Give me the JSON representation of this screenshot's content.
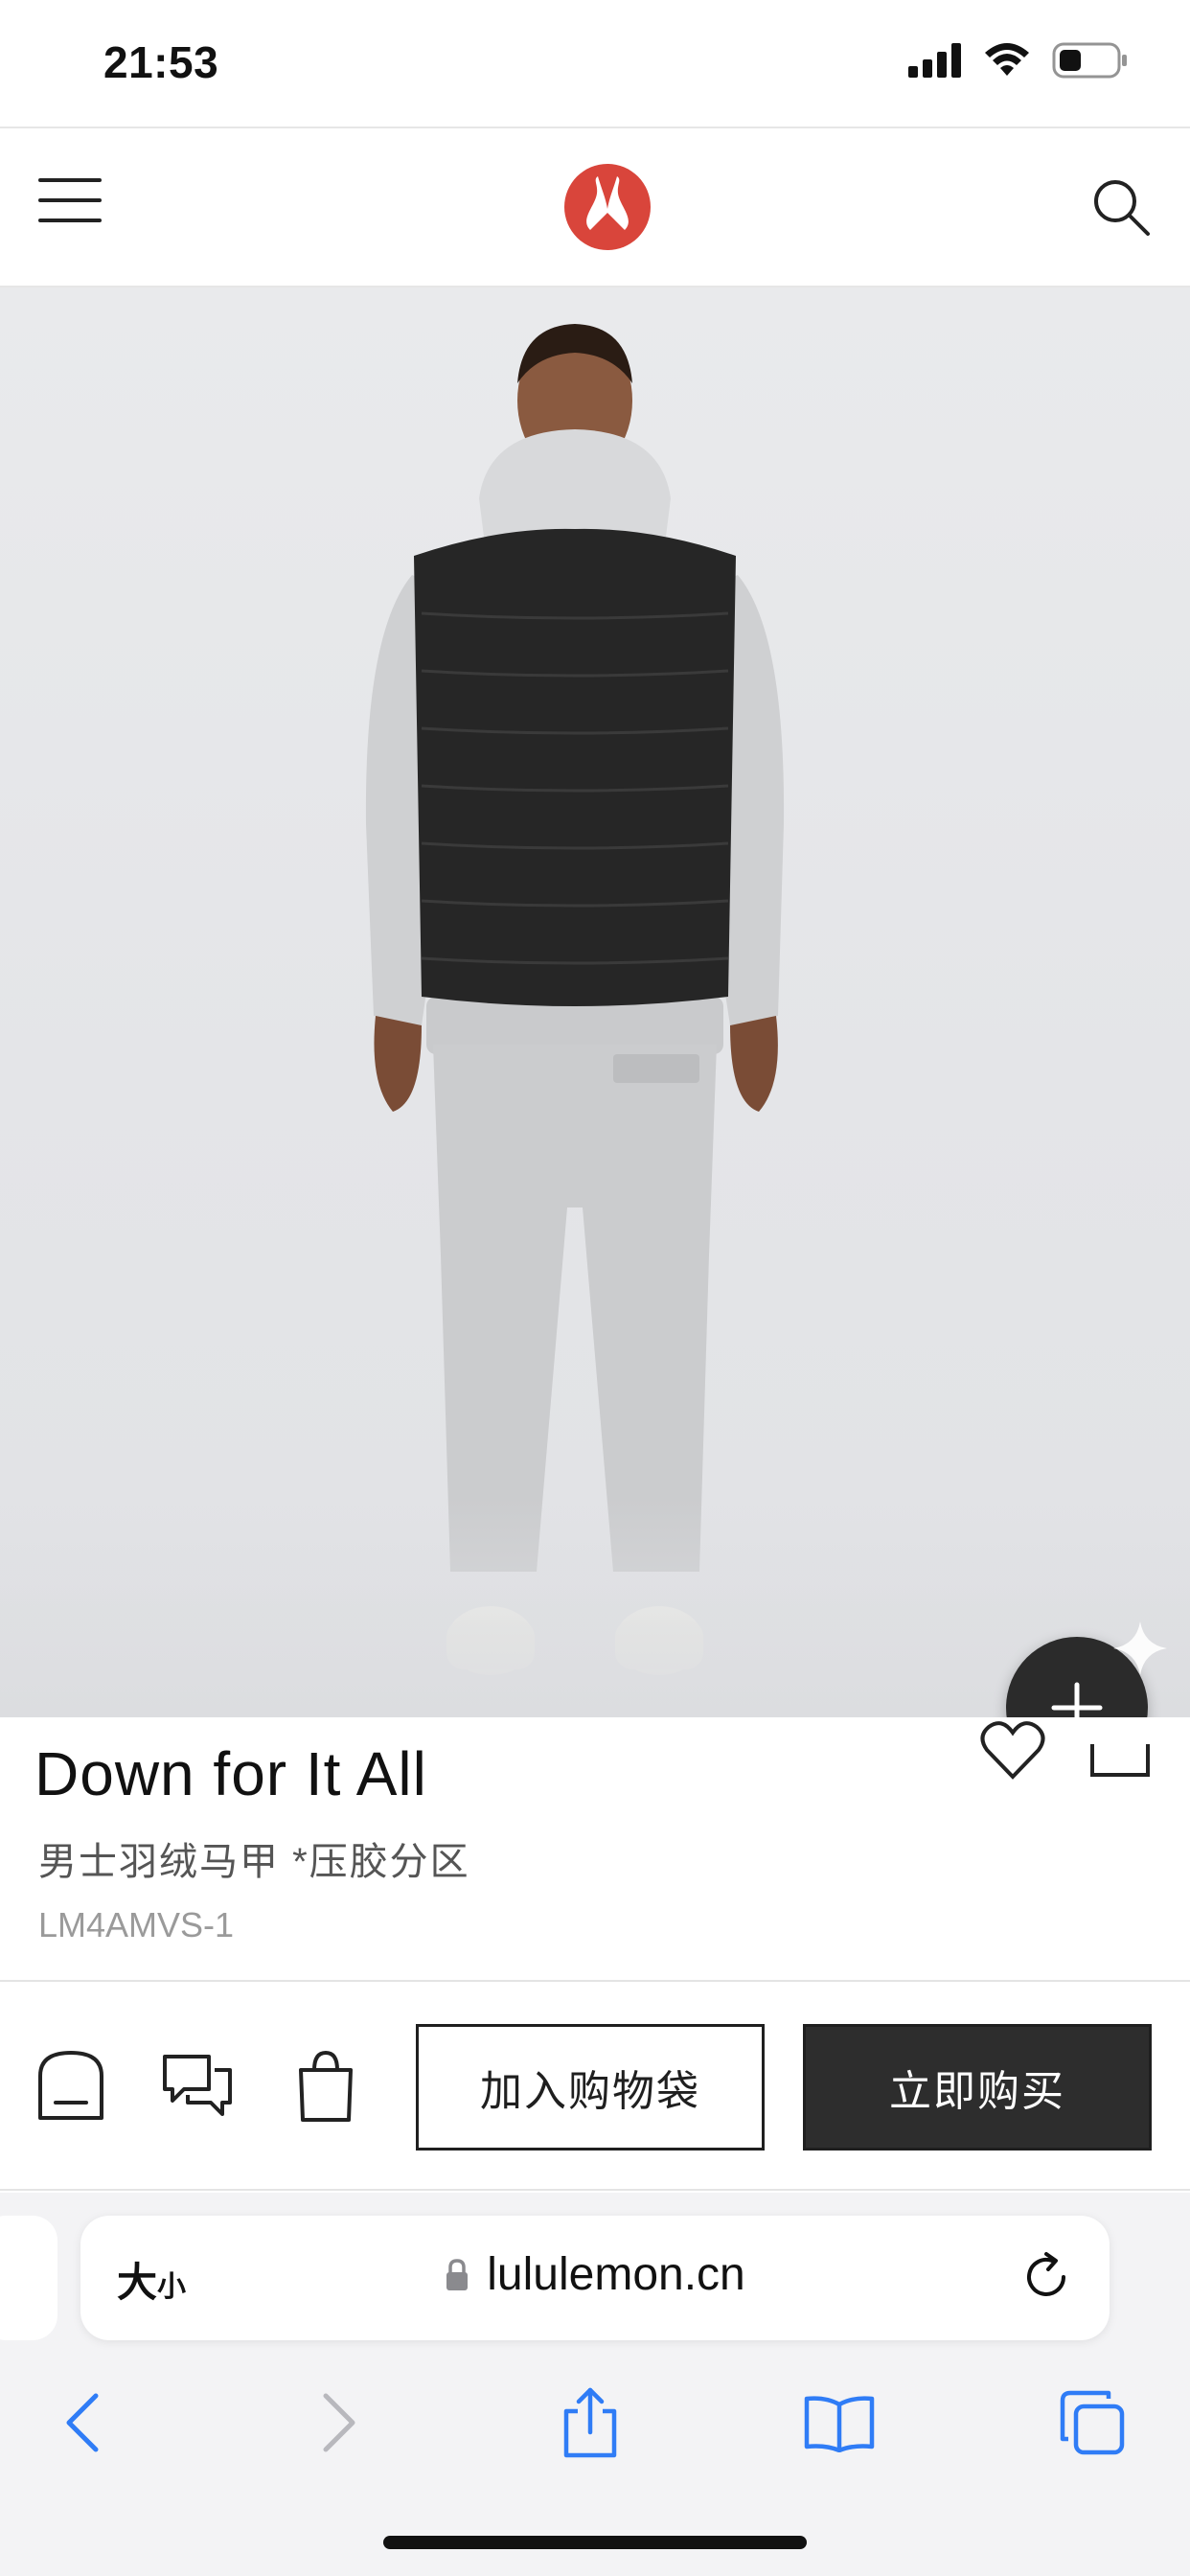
{
  "status_bar": {
    "time": "21:53"
  },
  "header": {
    "brand": "lululemon"
  },
  "product": {
    "title": "Down for It All",
    "subtitle": "男士羽绒马甲 *压胶分区",
    "sku": "LM4AMVS-1"
  },
  "actions": {
    "add_to_bag_label": "加入购物袋",
    "buy_now_label": "立即购买"
  },
  "browser": {
    "text_size_label_large": "大",
    "text_size_label_small": "小",
    "url": "lululemon.cn"
  },
  "colors": {
    "brand_red": "#d9453b",
    "button_dark": "#2d2d2d",
    "safari_blue": "#2f7cf6"
  },
  "icons": [
    "menu-icon",
    "lululemon-logo",
    "search-icon",
    "plus-icon",
    "heart-icon",
    "share-icon",
    "store-icon",
    "chat-icon",
    "bag-icon",
    "lock-icon",
    "reload-icon",
    "back-icon",
    "forward-icon",
    "share-sheet-icon",
    "bookmarks-icon",
    "tabs-icon"
  ]
}
